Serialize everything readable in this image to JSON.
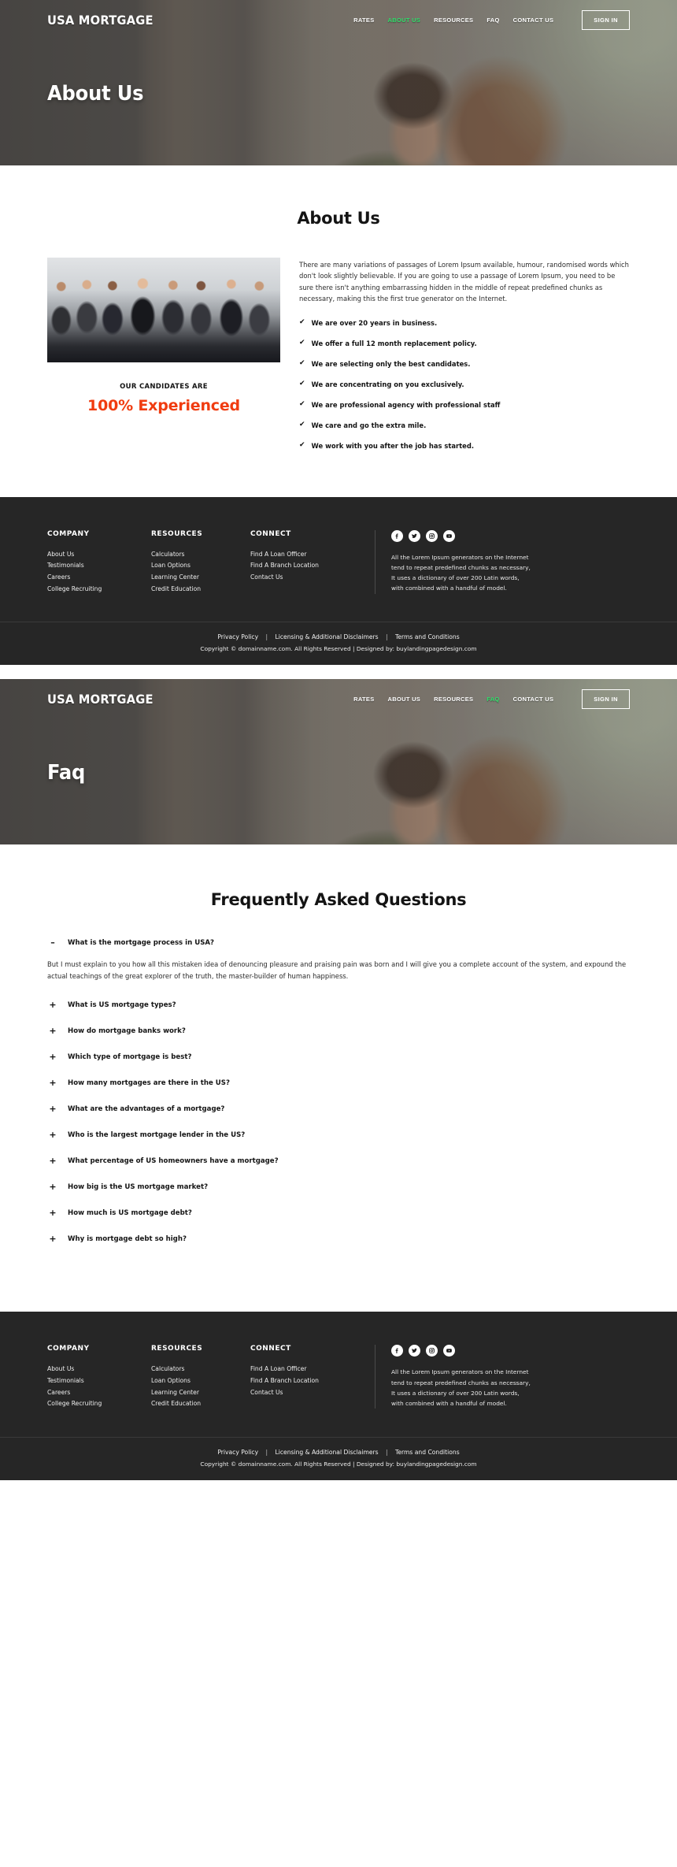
{
  "colors": {
    "accent_green": "#2fe06a",
    "accent_orange": "#F03C10",
    "footer_bg": "#262626",
    "hero_overlay": "#3a3836"
  },
  "brand": "USA MORTGAGE",
  "nav": {
    "links": [
      "RATES",
      "ABOUT US",
      "RESOURCES",
      "FAQ",
      "CONTACT US"
    ],
    "signin_label": "SIGN IN",
    "active_page1": "ABOUT US",
    "active_page2": "FAQ"
  },
  "page1": {
    "hero_title": "About Us",
    "section_title": "About Us",
    "paragraph": "There are many variations of passages of Lorem Ipsum available, humour, randomised words which don't look slightly believable. If you are going to use a passage of Lorem Ipsum, you need to be sure there isn't anything embarrassing hidden in the middle of repeat predefined chunks as necessary, making this the first true generator on the Internet.",
    "bullets": [
      "We are over 20 years in business.",
      "We offer a full 12 month replacement policy.",
      "We are selecting only the best candidates.",
      "We are concentrating on you exclusively.",
      "We are professional agency with professional staff",
      "We care and go the extra mile.",
      "We work with you after the job has started."
    ],
    "candidates_kicker": "OUR CANDIDATES ARE",
    "candidates_main": "100% Experienced",
    "check_icon": "✔"
  },
  "page2": {
    "hero_title": "Faq",
    "section_title": "Frequently Asked Questions",
    "open_question": "What is the mortgage process in USA?",
    "open_sign": "–",
    "open_answer": "But I must explain to you how all this mistaken idea of denouncing pleasure and praising pain was born and I will give you a complete account of the system, and expound the actual teachings of the great explorer of the truth, the master-builder of human happiness.",
    "closed_sign": "+",
    "questions": [
      "What is US mortgage types?",
      "How do mortgage banks work?",
      "Which type of mortgage is best?",
      "How many mortgages are there in the US?",
      "What are the advantages of a mortgage?",
      "Who is the largest mortgage lender in the US?",
      "What percentage of US homeowners have a mortgage?",
      "How big is the US mortgage market?",
      "How much is US mortgage debt?",
      "Why is mortgage debt so high?"
    ]
  },
  "footer": {
    "company_title": "COMPANY",
    "company_links": [
      "About Us",
      "Testimonials",
      "Careers",
      "College Recruiting"
    ],
    "resources_title": "RESOURCES",
    "resources_links": [
      "Calculators",
      "Loan Options",
      "Learning Center",
      "Credit Education"
    ],
    "connect_title": "CONNECT",
    "connect_links": [
      "Find A Loan Officer",
      "Find A Branch Location",
      "Contact Us"
    ],
    "socials": [
      "facebook-icon",
      "twitter-icon",
      "instagram-icon",
      "youtube-icon"
    ],
    "blurb": "All the Lorem Ipsum generators on the Internet tend to repeat predefined chunks as necessary, It uses a dictionary of over 200 Latin words, with combined with a handful of model.",
    "bottom_links": [
      "Privacy Policy",
      "Licensing & Additional Disclaimers",
      "Terms and Conditions"
    ],
    "separator": "|",
    "copyright": "Copyright © domainname.com. All Rights Reserved | Designed by: buylandingpagedesign.com"
  }
}
